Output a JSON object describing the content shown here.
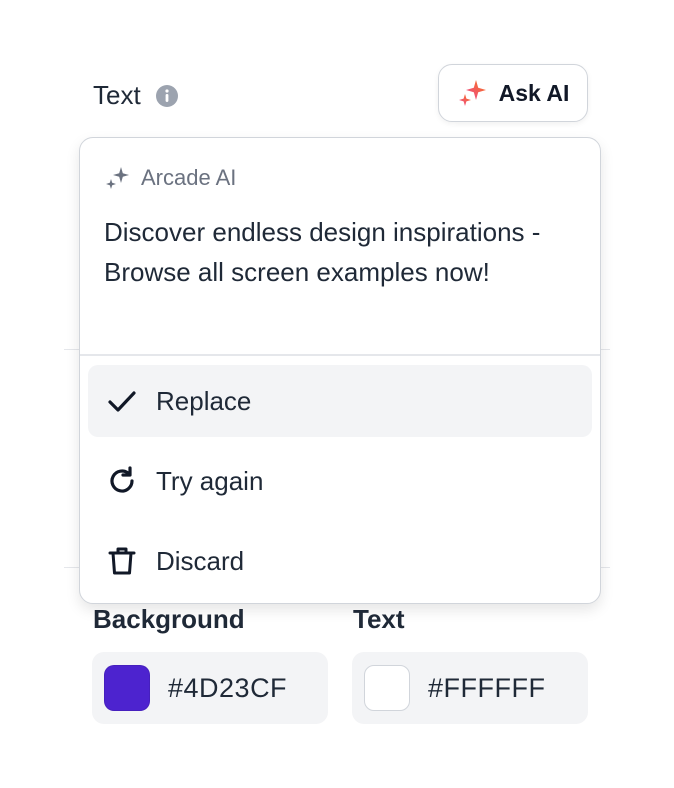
{
  "header": {
    "label": "Text",
    "ask_ai_label": "Ask AI"
  },
  "popup": {
    "title": "Arcade AI",
    "suggestion": "Discover endless design inspirations - Browse all screen examples now!",
    "actions": [
      {
        "label": "Replace",
        "icon": "check-icon"
      },
      {
        "label": "Try again",
        "icon": "refresh-icon"
      },
      {
        "label": "Discard",
        "icon": "trash-icon"
      }
    ]
  },
  "colors": {
    "background": {
      "label": "Background",
      "hex": "#4D23CF"
    },
    "text": {
      "label": "Text",
      "hex": "#FFFFFF"
    }
  },
  "palette": {
    "accent_purple": "#4D23CF",
    "sparkle_orange": "#F97316",
    "sparkle_pink": "#EC4899"
  }
}
